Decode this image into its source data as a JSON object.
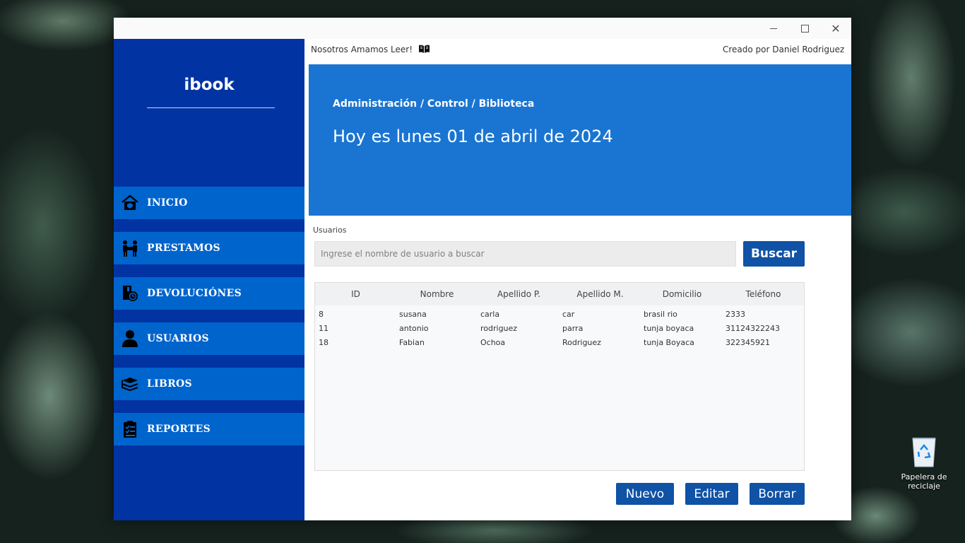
{
  "window": {
    "controls": {
      "minimize": "",
      "maximize": "",
      "close": "✕"
    }
  },
  "sidebar": {
    "brand": "ibook",
    "items": [
      {
        "label": "INICIO",
        "icon": "home-icon"
      },
      {
        "label": "PRESTAMOS",
        "icon": "loan-people-icon"
      },
      {
        "label": "DEVOLUCIÓNES",
        "icon": "return-icon"
      },
      {
        "label": "USUARIOS",
        "icon": "user-icon"
      },
      {
        "label": "LIBROS",
        "icon": "books-icon"
      },
      {
        "label": "REPORTES",
        "icon": "clipboard-icon"
      }
    ]
  },
  "header": {
    "tagline": "Nosotros Amamos Leer!",
    "credit": "Creado por Daniel Rodriguez"
  },
  "banner": {
    "breadcrumb": "Administración / Control / Biblioteca",
    "date": "Hoy es lunes 01 de abril de 2024"
  },
  "users": {
    "section_label": "Usuarios",
    "search_placeholder": "Ingrese el nombre de usuario a buscar",
    "search_value": "",
    "search_button": "Buscar",
    "columns": [
      "ID",
      "Nombre",
      "Apellido P.",
      "Apellido M.",
      "Domicilio",
      "Teléfono"
    ],
    "rows": [
      [
        "8",
        "susana",
        "carla",
        "car",
        "brasil rio",
        "2333"
      ],
      [
        "11",
        "antonio",
        "rodriguez",
        "parra",
        "tunja boyaca",
        "31124322243"
      ],
      [
        "18",
        "Fabian",
        "Ochoa",
        "Rodriguez",
        "tunja Boyaca",
        "322345921"
      ]
    ],
    "actions": {
      "new": "Nuevo",
      "edit": "Editar",
      "delete": "Borrar"
    }
  },
  "desktop": {
    "recycle_bin_label": "Papelera de reciclaje"
  },
  "colors": {
    "sidebar": "#0133a3",
    "nav_item": "#0064cd",
    "banner": "#1a75d2",
    "button": "#0f52a6"
  }
}
